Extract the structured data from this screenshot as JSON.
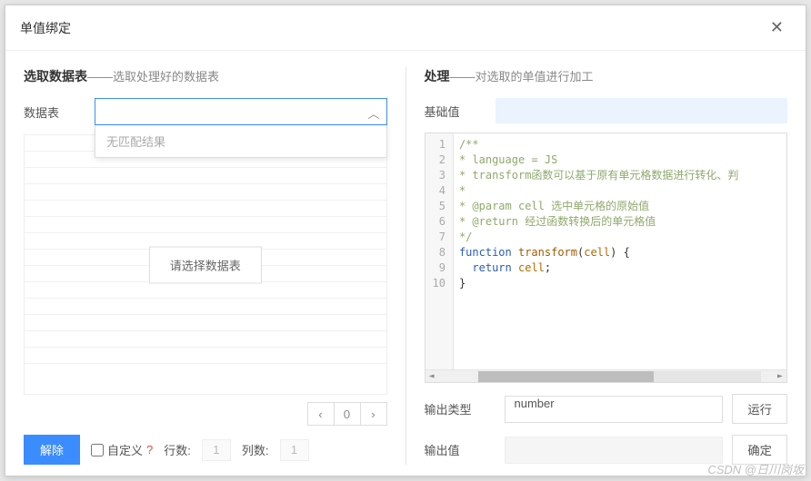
{
  "modal": {
    "title": "单值绑定"
  },
  "left": {
    "section_title": "选取数据表",
    "section_sub": "选取处理好的数据表",
    "table_label": "数据表",
    "dropdown_empty": "无匹配结果",
    "grid_placeholder": "请选择数据表",
    "pager": {
      "prev": "‹",
      "current": "0",
      "next": "›"
    },
    "unbind_btn": "解除",
    "custom_label": "自定义",
    "custom_help": "?",
    "rows_label": "行数:",
    "rows_value": "1",
    "cols_label": "列数:",
    "cols_value": "1"
  },
  "right": {
    "section_title": "处理",
    "section_sub": "对选取的单值进行加工",
    "base_value_label": "基础值",
    "output_type_label": "输出类型",
    "output_type_value": "number",
    "run_btn": "运行",
    "output_value_label": "输出值",
    "confirm_btn": "确定"
  },
  "code": {
    "lines": [
      {
        "n": "1",
        "html": "<span class='tok-comment'>/**</span>"
      },
      {
        "n": "2",
        "html": "<span class='tok-comment'> * language = JS</span>"
      },
      {
        "n": "3",
        "html": "<span class='tok-comment'> * transform函数可以基于原有单元格数据进行转化、判</span>"
      },
      {
        "n": "4",
        "html": "<span class='tok-comment'> *</span>"
      },
      {
        "n": "5",
        "html": "<span class='tok-comment'> * @param cell 选中单元格的原始值</span>"
      },
      {
        "n": "6",
        "html": "<span class='tok-comment'> * @return 经过函数转换后的单元格值</span>"
      },
      {
        "n": "7",
        "html": "<span class='tok-comment'> */</span>"
      },
      {
        "n": "8",
        "html": "<span class='tok-keyword'>function</span> <span class='tok-func'>transform</span>(<span class='tok-param'>cell</span>) {"
      },
      {
        "n": "9",
        "html": "&nbsp;&nbsp;<span class='tok-keyword'>return</span> <span class='tok-param'>cell</span>;"
      },
      {
        "n": "10",
        "html": "}"
      }
    ]
  },
  "watermark": "CSDN @日川岗坂"
}
